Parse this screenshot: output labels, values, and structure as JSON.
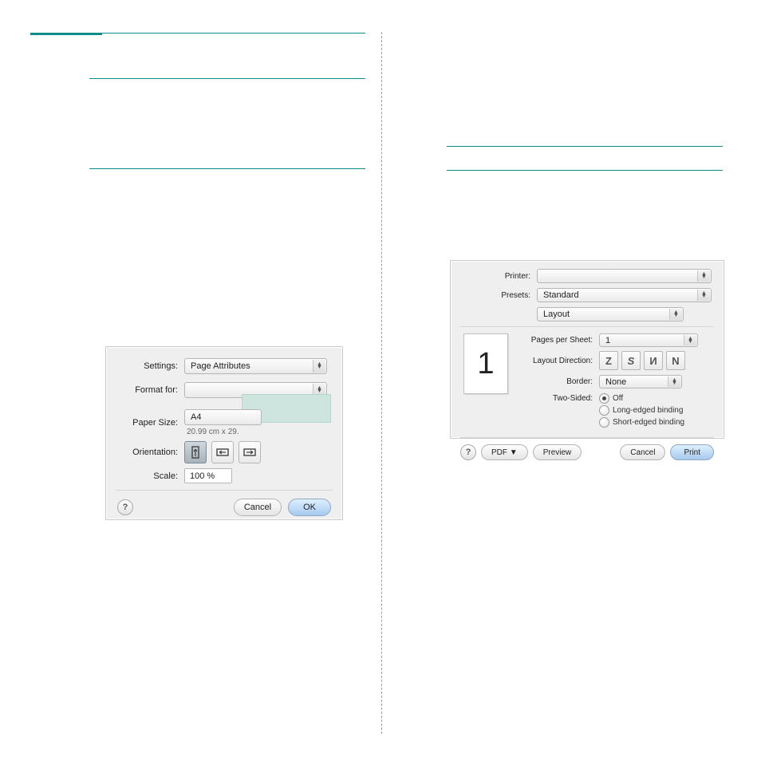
{
  "page_setup": {
    "settings_label": "Settings:",
    "settings_value": "Page Attributes",
    "format_for_label": "Format for:",
    "format_for_value": "",
    "paper_size_label": "Paper Size:",
    "paper_size_value": "A4",
    "paper_size_dims": "20.99 cm x 29.",
    "orientation_label": "Orientation:",
    "scale_label": "Scale:",
    "scale_value": "100 %",
    "cancel": "Cancel",
    "ok": "OK",
    "help": "?"
  },
  "print": {
    "printer_label": "Printer:",
    "printer_value": "",
    "presets_label": "Presets:",
    "presets_value": "Standard",
    "pane_value": "Layout",
    "preview_number": "1",
    "pages_per_sheet_label": "Pages per Sheet:",
    "pages_per_sheet_value": "1",
    "layout_direction_label": "Layout Direction:",
    "border_label": "Border:",
    "border_value": "None",
    "two_sided_label": "Two-Sided:",
    "two_sided_options": {
      "off": "Off",
      "long": "Long-edged binding",
      "short": "Short-edged binding"
    },
    "help": "?",
    "pdf": "PDF ▼",
    "preview": "Preview",
    "cancel": "Cancel",
    "print_btn": "Print"
  }
}
